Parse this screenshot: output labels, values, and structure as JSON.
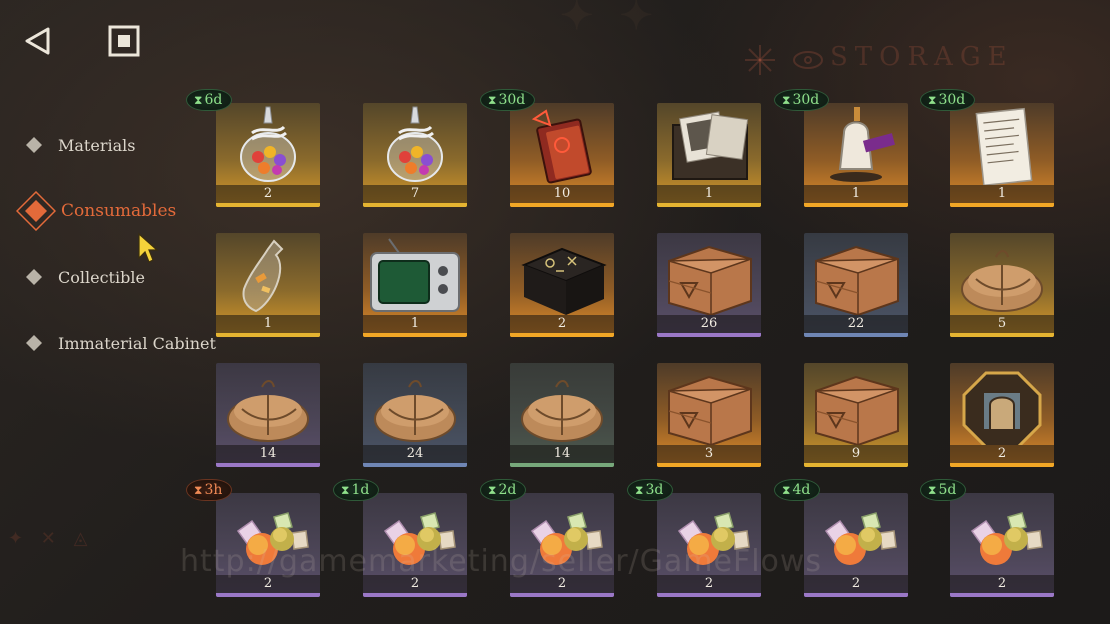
{
  "header": {
    "back_icon": "back-triangle-icon",
    "stop_icon": "stop-square-icon",
    "storage_title": "STORAGE"
  },
  "sidebar": {
    "items": [
      {
        "label": "Materials",
        "active": false
      },
      {
        "label": "Consumables",
        "active": true
      },
      {
        "label": "Collectible",
        "active": false
      },
      {
        "label": "Immaterial Cabinet",
        "active": false
      }
    ]
  },
  "colors": {
    "accent": "#e36a3a",
    "timer_green": "#8fe08b",
    "timer_orange": "#ef8a55",
    "rarity_gold": "#e5b431",
    "rarity_orange": "#f2a726",
    "rarity_purple": "#9b78c7",
    "rarity_blue": "#6f86b5",
    "rarity_green": "#77a87b"
  },
  "grid": {
    "rows": [
      [
        {
          "icon": "candy-jar-icon",
          "quantity": "2",
          "rarity": "gold",
          "timer": "6d"
        },
        {
          "icon": "candy-jar-icon",
          "quantity": "7",
          "rarity": "gold",
          "timer": ""
        },
        {
          "icon": "tome-icon",
          "quantity": "10",
          "rarity": "orange",
          "timer": "30d"
        },
        {
          "icon": "photo-box-icon",
          "quantity": "1",
          "rarity": "gold",
          "timer": ""
        },
        {
          "icon": "tailoring-kit-icon",
          "quantity": "1",
          "rarity": "orange",
          "timer": "30d"
        },
        {
          "icon": "shopping-list-icon",
          "quantity": "1",
          "rarity": "orange",
          "timer": "30d"
        }
      ],
      [
        {
          "icon": "message-bottle-icon",
          "quantity": "1",
          "rarity": "gold",
          "timer": ""
        },
        {
          "icon": "retro-tv-icon",
          "quantity": "1",
          "rarity": "orange",
          "timer": ""
        },
        {
          "icon": "rune-table-icon",
          "quantity": "2",
          "rarity": "orange",
          "timer": ""
        },
        {
          "icon": "wooden-crate-icon",
          "quantity": "26",
          "rarity": "purple",
          "timer": ""
        },
        {
          "icon": "wooden-crate-icon",
          "quantity": "22",
          "rarity": "blue",
          "timer": ""
        },
        {
          "icon": "cloth-bundle-icon",
          "quantity": "5",
          "rarity": "gold",
          "timer": ""
        }
      ],
      [
        {
          "icon": "cloth-bundle-icon",
          "quantity": "14",
          "rarity": "purple",
          "timer": ""
        },
        {
          "icon": "cloth-bundle-icon",
          "quantity": "24",
          "rarity": "blue",
          "timer": ""
        },
        {
          "icon": "cloth-bundle-icon",
          "quantity": "14",
          "rarity": "green",
          "timer": ""
        },
        {
          "icon": "wooden-crate-icon",
          "quantity": "3",
          "rarity": "orange",
          "timer": ""
        },
        {
          "icon": "wooden-crate-icon",
          "quantity": "9",
          "rarity": "gold",
          "timer": ""
        },
        {
          "icon": "octagon-emblem-icon",
          "quantity": "2",
          "rarity": "orange",
          "timer": ""
        }
      ],
      [
        {
          "icon": "fruit-candy-icon",
          "quantity": "2",
          "rarity": "purple",
          "timer": "3h",
          "urgent": true
        },
        {
          "icon": "fruit-candy-icon",
          "quantity": "2",
          "rarity": "purple",
          "timer": "1d"
        },
        {
          "icon": "fruit-candy-icon",
          "quantity": "2",
          "rarity": "purple",
          "timer": "2d"
        },
        {
          "icon": "fruit-candy-icon",
          "quantity": "2",
          "rarity": "purple",
          "timer": "3d"
        },
        {
          "icon": "fruit-candy-icon",
          "quantity": "2",
          "rarity": "purple",
          "timer": "4d"
        },
        {
          "icon": "fruit-candy-icon",
          "quantity": "2",
          "rarity": "purple",
          "timer": "5d"
        }
      ]
    ]
  },
  "watermark_text": "http://gamemarketing/seller/GameFlows"
}
